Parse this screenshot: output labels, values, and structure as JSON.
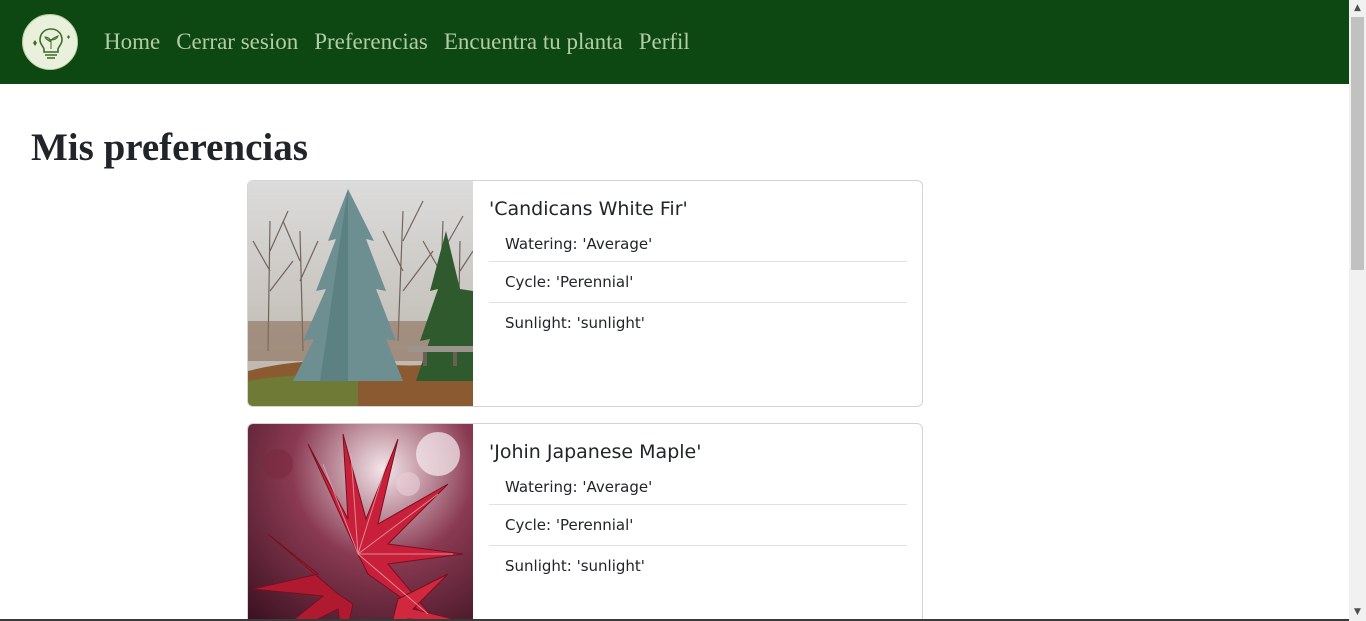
{
  "nav": {
    "logo_icon": "lightbulb-plant-icon",
    "links": [
      "Home",
      "Cerrar sesion",
      "Preferencias",
      "Encuentra tu planta",
      "Perfil"
    ]
  },
  "page": {
    "title": "Mis preferencias"
  },
  "plants": [
    {
      "name": "'Candicans White Fir'",
      "watering": "Watering: 'Average'",
      "cycle": "Cycle: 'Perennial'",
      "sunlight": "Sunlight: 'sunlight'",
      "image_icon": "fir-tree-photo"
    },
    {
      "name": "'Johin Japanese Maple'",
      "watering": "Watering: 'Average'",
      "cycle": "Cycle: 'Perennial'",
      "sunlight": "Sunlight: 'sunlight'",
      "image_icon": "maple-leaf-photo"
    }
  ],
  "colors": {
    "navbar": "#0d4711",
    "nav_link": "#b3cca6",
    "text": "#212529"
  }
}
